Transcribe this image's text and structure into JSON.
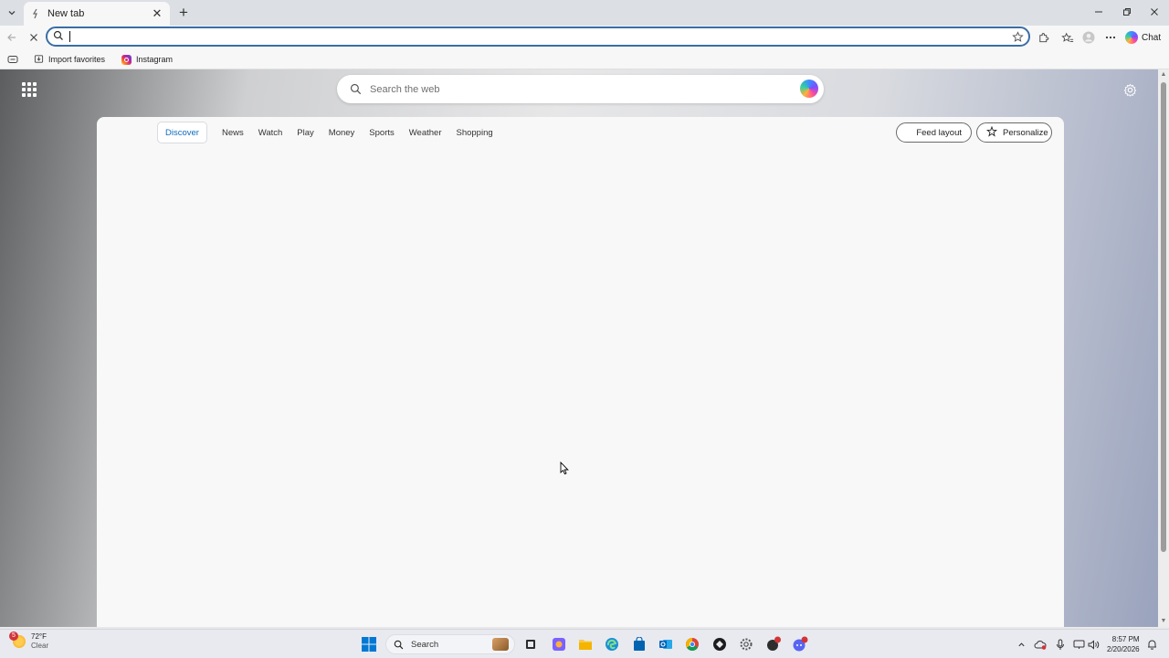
{
  "browser": {
    "tab_title": "New tab",
    "address_value": "",
    "chat_label": "Chat"
  },
  "favorites": {
    "items": [
      {
        "label": "Import favorites"
      },
      {
        "label": "Instagram"
      }
    ]
  },
  "newtab": {
    "search_placeholder": "Search the web",
    "nav": [
      {
        "label": "Discover",
        "active": true
      },
      {
        "label": "News"
      },
      {
        "label": "Watch"
      },
      {
        "label": "Play"
      },
      {
        "label": "Money"
      },
      {
        "label": "Sports"
      },
      {
        "label": "Weather"
      },
      {
        "label": "Shopping"
      }
    ],
    "feed_layout_label": "Feed layout",
    "personalize_label": "Personalize"
  },
  "taskbar": {
    "weather_temp": "72°F",
    "weather_condition": "Clear",
    "weather_badge": "5",
    "search_label": "Search",
    "time": "8:57 PM",
    "date": "2/20/2026"
  },
  "colors": {
    "accent": "#0f6cbd",
    "address_border": "#3a6ea5",
    "windows_blue": "#0078d4"
  }
}
